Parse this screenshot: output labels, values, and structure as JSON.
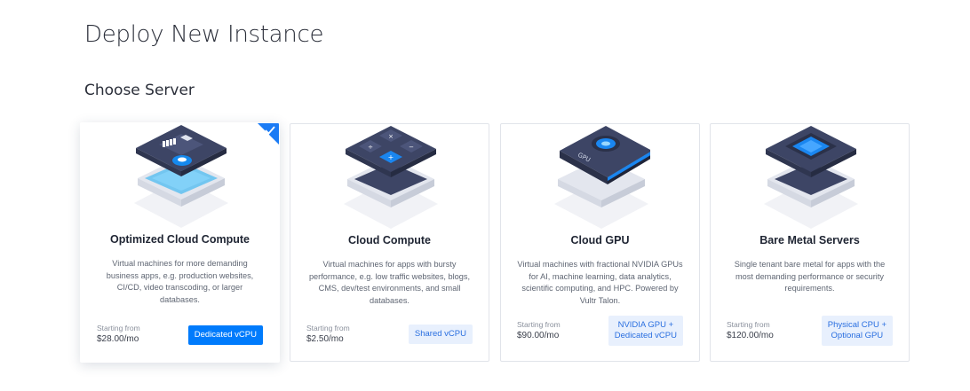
{
  "page": {
    "title": "Deploy New Instance",
    "section_title": "Choose Server"
  },
  "colors": {
    "accent": "#007bfc",
    "badge_bg": "#e8f0fd",
    "badge_text": "#2a6fe0",
    "server_dark": "#3d4565",
    "server_light": "#eef0f5"
  },
  "cards": [
    {
      "name": "Optimized Cloud Compute",
      "description": "Virtual machines for more demanding business apps, e.g. production websites, CI/CD, video transcoding, or larger databases.",
      "price_label": "Starting from",
      "price": "$28.00/mo",
      "badge": "Dedicated vCPU",
      "selected": true,
      "icon": "optimized-compute-server-icon"
    },
    {
      "name": "Cloud Compute",
      "description": "Virtual machines for apps with bursty performance, e.g. low traffic websites, blogs, CMS, dev/test environments, and small databases.",
      "price_label": "Starting from",
      "price": "$2.50/mo",
      "badge": "Shared vCPU",
      "selected": false,
      "icon": "cloud-compute-server-icon"
    },
    {
      "name": "Cloud GPU",
      "description": "Virtual machines with fractional NVIDIA GPUs for AI, machine learning, data analytics, scientific computing, and HPC. Powered by Vultr Talon.",
      "price_label": "Starting from",
      "price": "$90.00/mo",
      "badge_line1": "NVIDIA GPU +",
      "badge_line2": "Dedicated vCPU",
      "gpu_label": "GPU",
      "selected": false,
      "icon": "gpu-card-icon"
    },
    {
      "name": "Bare Metal Servers",
      "description": "Single tenant bare metal for apps with the most demanding performance or security requirements.",
      "price_label": "Starting from",
      "price": "$120.00/mo",
      "badge_line1": "Physical CPU +",
      "badge_line2": "Optional GPU",
      "selected": false,
      "icon": "bare-metal-server-icon"
    }
  ]
}
